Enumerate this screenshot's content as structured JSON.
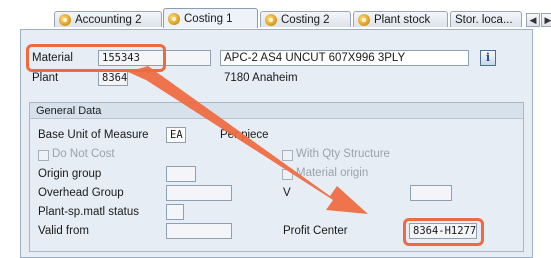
{
  "tabs": [
    {
      "label": "Accounting 2",
      "active": false
    },
    {
      "label": "Costing 1",
      "active": true
    },
    {
      "label": "Costing 2",
      "active": false
    },
    {
      "label": "Plant stock",
      "active": false
    },
    {
      "label": "Stor. loca...",
      "active": false
    }
  ],
  "header": {
    "material_label": "Material",
    "material_value": "155343",
    "material_description": "APC-2 AS4 UNCUT 607X996 3PLY",
    "plant_label": "Plant",
    "plant_value": "8364",
    "plant_description": "7180 Anaheim",
    "info_glyph": "i"
  },
  "general_data": {
    "title": "General Data",
    "base_uom_label": "Base Unit of Measure",
    "base_uom_value": "EA",
    "base_uom_text": "Per piece",
    "do_not_cost_label": "Do Not Cost",
    "with_qty_structure_label": "With Qty Structure",
    "origin_group_label": "Origin group",
    "material_origin_label": "Material origin",
    "overhead_group_label": "Overhead Group",
    "v_label": "V",
    "plant_sp_status_label": "Plant-sp.matl status",
    "valid_from_label": "Valid from",
    "profit_center_label": "Profit Center",
    "profit_center_value": "8364-H1277"
  },
  "colors": {
    "highlight": "#ef6a3f",
    "panel": "#e7edf4"
  }
}
